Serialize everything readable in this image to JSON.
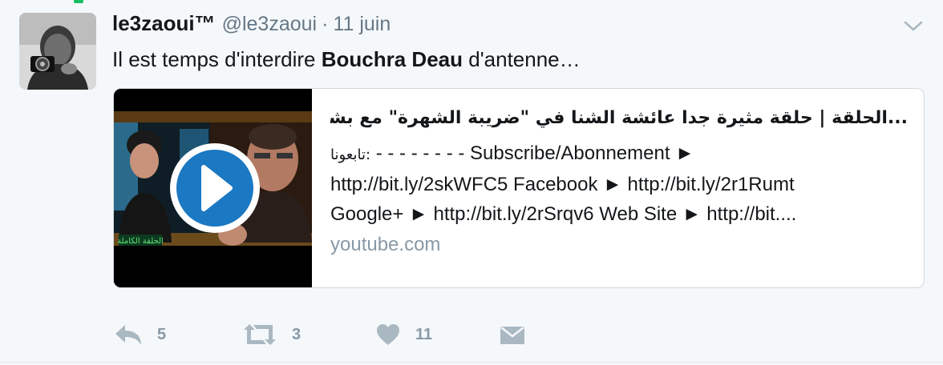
{
  "tweet": {
    "fullname": "le3zaoui™",
    "username": "@le3zaoui",
    "separator": "·",
    "time": "11 juin",
    "text_before": "Il est temps d'interdire ",
    "text_bold": "Bouchra Deau",
    "text_after": " d'antenne…"
  },
  "card": {
    "title": "...الحلقة | حلقة مثيرة جدا عائشة الشنا في \"ضريبة الشهرة\" مع بشرى الضو",
    "desc_rtl": "تابعونا:",
    "desc_line1": " - - - - - - - - Subscribe/Abonnement ►",
    "desc_line2": "http://bit.ly/2skWFC5 Facebook ► http://bit.ly/2r1Rumt",
    "desc_line3": "Google+ ► http://bit.ly/2rSrqv6 Web Site ► http://bit....",
    "domain": "youtube.com",
    "thumb_banner": "الحلقة الكاملة"
  },
  "actions": {
    "reply_count": "5",
    "retweet_count": "3",
    "like_count": "11"
  },
  "colors": {
    "background": "#f5f8fa",
    "muted": "#657786",
    "action_gray": "#8899a6",
    "play_blue": "#1b78c2",
    "green_mark": "#17bf63"
  },
  "icons": [
    "chevron-down-icon",
    "play-icon",
    "reply-icon",
    "retweet-icon",
    "heart-icon",
    "direct-message-icon"
  ]
}
